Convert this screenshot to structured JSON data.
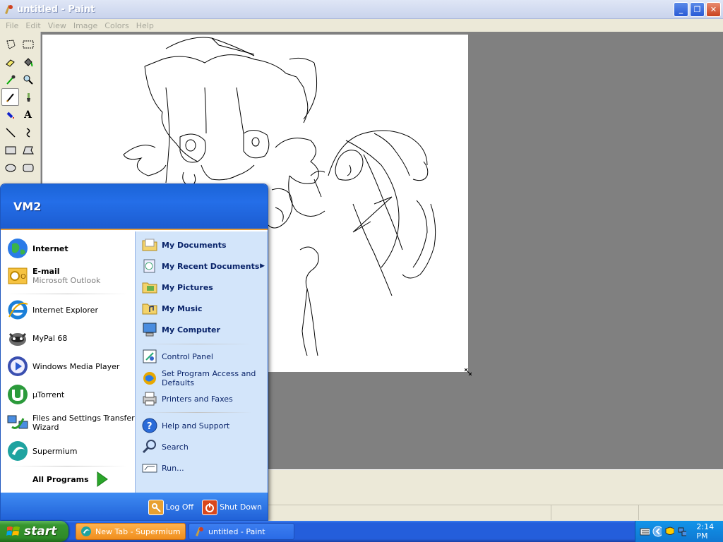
{
  "window": {
    "title": "untitled - Paint"
  },
  "menu": [
    "File",
    "Edit",
    "View",
    "Image",
    "Colors",
    "Help"
  ],
  "tools": [
    "free-form-select",
    "select",
    "eraser",
    "fill",
    "color-picker",
    "magnifier",
    "pencil",
    "brush",
    "airbrush",
    "text",
    "line",
    "curve",
    "rectangle",
    "polygon",
    "ellipse",
    "rounded-rectangle"
  ],
  "start_menu": {
    "user": "VM2",
    "pinned": [
      {
        "label": "Internet",
        "sub": "",
        "icon": "globe-icon"
      },
      {
        "label": "E-mail",
        "sub": "Microsoft Outlook",
        "icon": "outlook-icon"
      }
    ],
    "recent": [
      {
        "label": "Internet Explorer",
        "icon": "ie-icon"
      },
      {
        "label": "MyPal 68",
        "icon": "mypal-icon"
      },
      {
        "label": "Windows Media Player",
        "icon": "wmp-icon"
      },
      {
        "label": "µTorrent",
        "icon": "utorrent-icon"
      },
      {
        "label": "Files and Settings Transfer",
        "label2": "Wizard",
        "icon": "transfer-icon"
      },
      {
        "label": "Supermium",
        "icon": "supermium-icon"
      }
    ],
    "all_programs": "All Programs",
    "right_bold": [
      {
        "label": "My Documents",
        "icon": "folder-icon"
      },
      {
        "label": "My Recent Documents",
        "icon": "recent-docs-icon"
      },
      {
        "label": "My Pictures",
        "icon": "pictures-icon"
      },
      {
        "label": "My Music",
        "icon": "music-icon"
      },
      {
        "label": "My Computer",
        "icon": "computer-icon"
      }
    ],
    "right_normal": [
      {
        "label": "Control Panel",
        "icon": "control-panel-icon"
      },
      {
        "label": "Set Program Access and",
        "label2": "Defaults",
        "icon": "program-access-icon"
      },
      {
        "label": "Printers and Faxes",
        "icon": "printer-icon"
      }
    ],
    "right_help": [
      {
        "label": "Help and Support",
        "icon": "help-icon"
      },
      {
        "label": "Search",
        "icon": "search-icon"
      },
      {
        "label": "Run...",
        "icon": "run-icon"
      }
    ],
    "log_off": "Log Off",
    "shut_down": "Shut Down"
  },
  "taskbar": {
    "start": "start",
    "tasks": [
      {
        "label": "New Tab - Supermium",
        "active": false
      },
      {
        "label": "untitled - Paint",
        "active": true
      }
    ],
    "clock": "2:14 PM"
  },
  "colors": {
    "xp_blue": "#245edb",
    "start_green": "#37962f",
    "menu_right": "#d3e5fa"
  }
}
